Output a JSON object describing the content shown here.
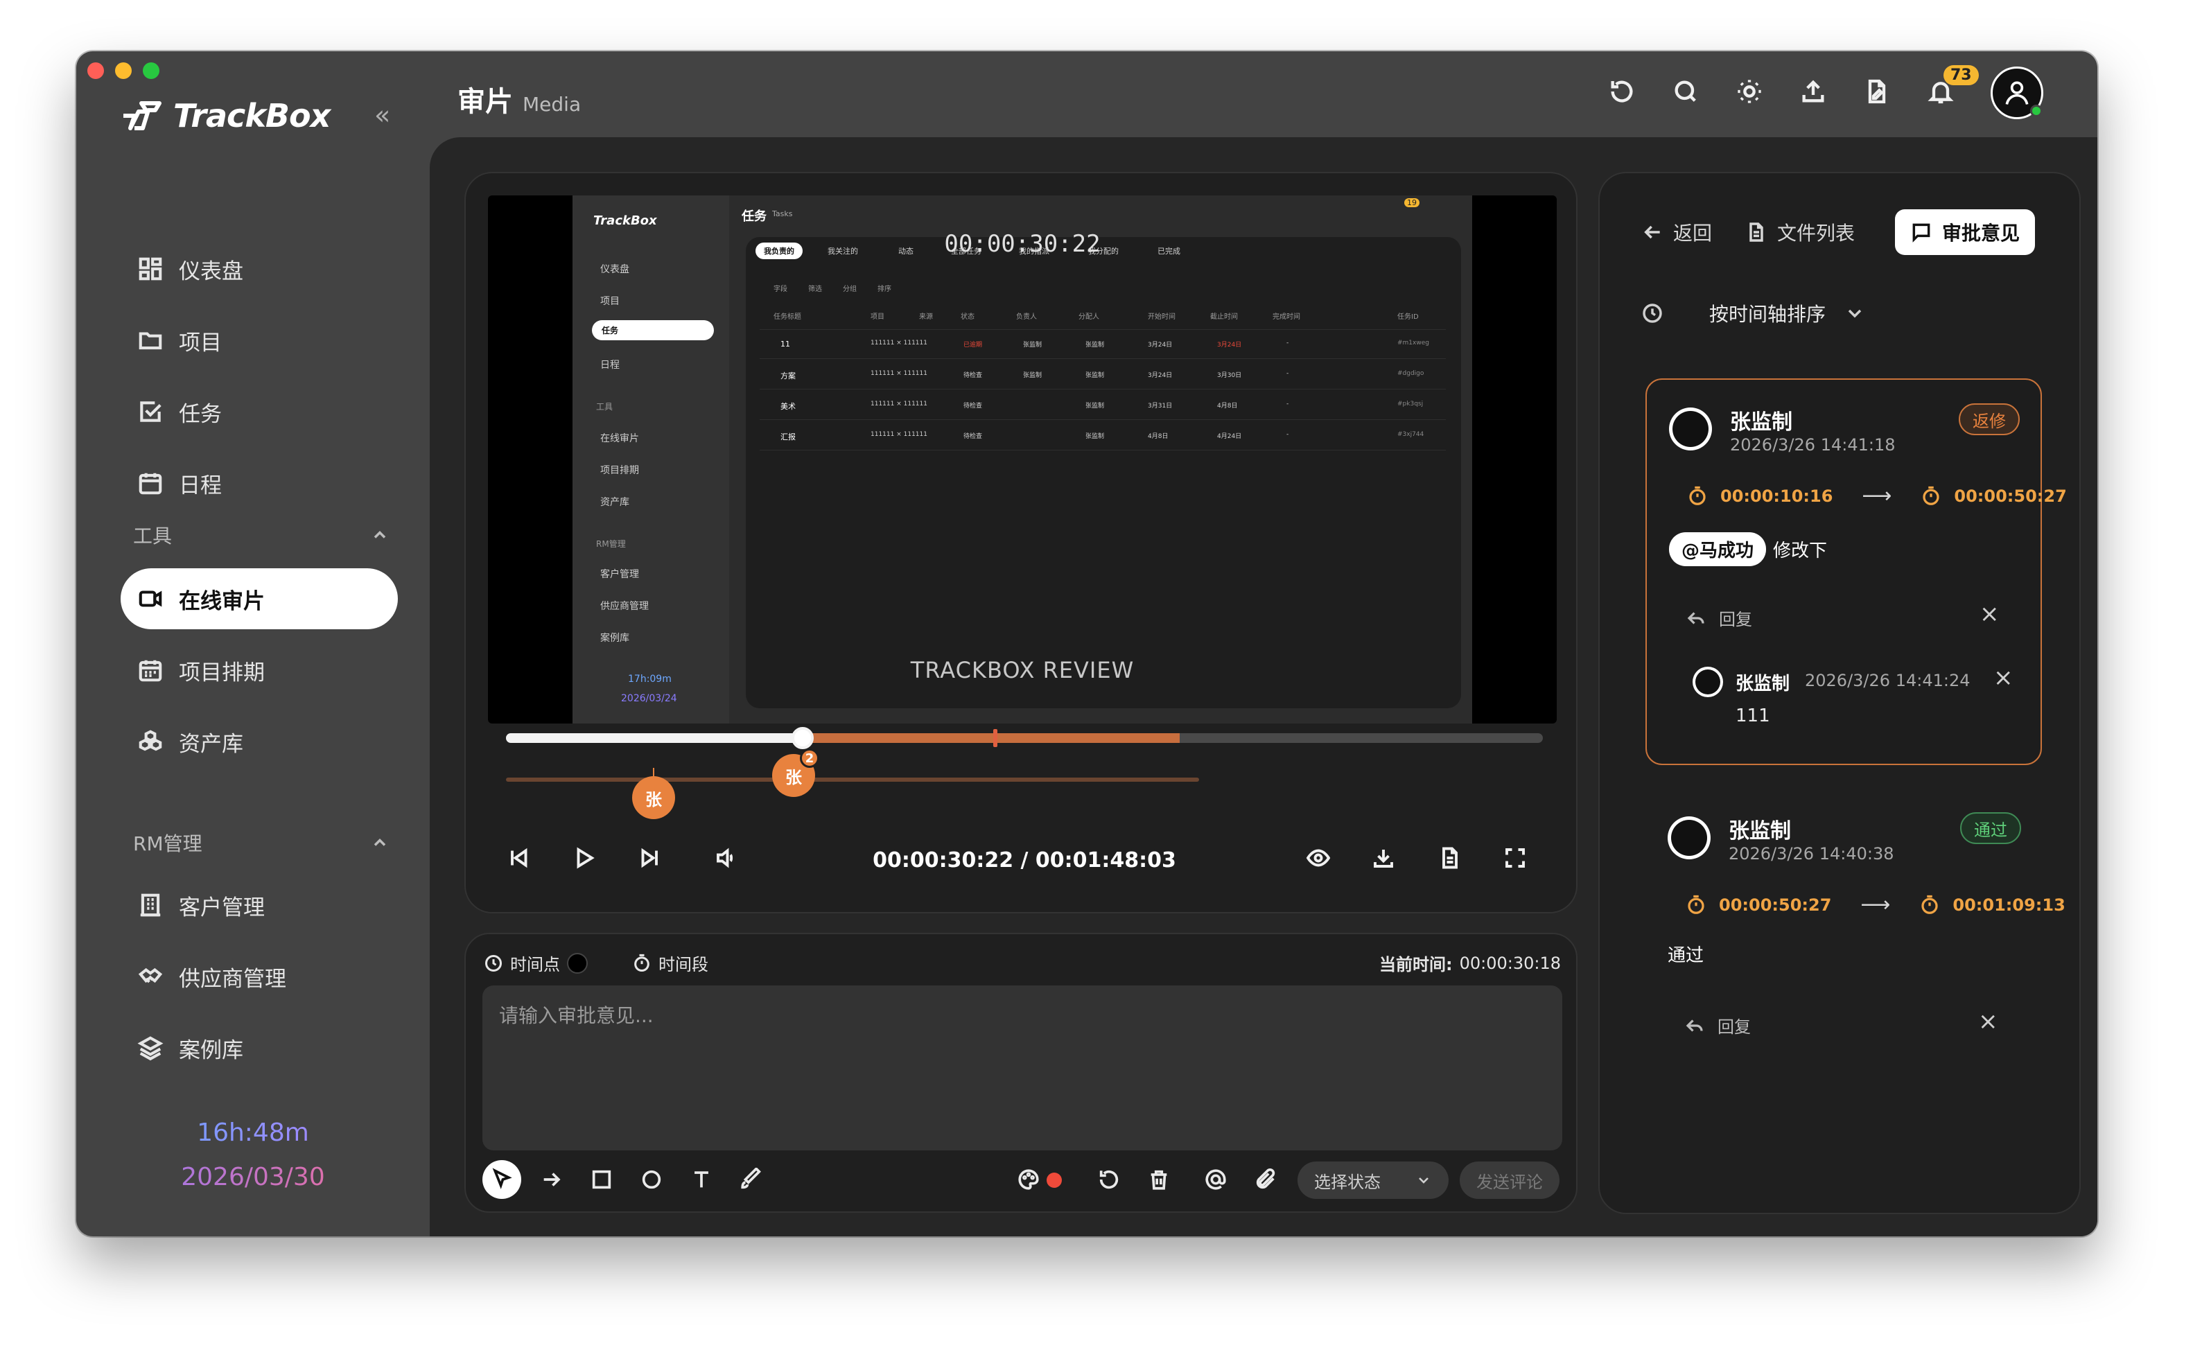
{
  "app": {
    "name": "TrackBox"
  },
  "page": {
    "title": "审片",
    "subtitle": "Media"
  },
  "sidebar": {
    "items": [
      {
        "label": "仪表盘"
      },
      {
        "label": "项目"
      },
      {
        "label": "任务"
      },
      {
        "label": "日程"
      }
    ],
    "section_tools": "工具",
    "tools": [
      {
        "label": "在线审片"
      },
      {
        "label": "项目排期"
      },
      {
        "label": "资产库"
      }
    ],
    "section_rm": "RM管理",
    "rm": [
      {
        "label": "客户管理"
      },
      {
        "label": "供应商管理"
      },
      {
        "label": "案例库"
      }
    ],
    "clock_time": "16h:48m",
    "clock_date": "2026/03/30"
  },
  "topbar": {
    "notification_count": "73"
  },
  "player": {
    "overlay_timecode": "00:00:30:22",
    "watermark": "TRACKBOX REVIEW",
    "played_fraction": 0.286,
    "markers": [
      {
        "label": "张",
        "count": ""
      },
      {
        "label": "张",
        "count": "2"
      }
    ],
    "time_display": "00:00:30:22 / 00:01:48:03"
  },
  "embedded": {
    "logo": "TrackBox",
    "title": "任务",
    "subtitle": "Tasks",
    "badge": "19",
    "tabs": [
      "我负责的",
      "我关注的",
      "动态",
      "全部任务",
      "我的指派",
      "我分配的",
      "已完成"
    ],
    "filters": [
      "字段",
      "筛选",
      "分组",
      "排序"
    ],
    "nav": [
      "仪表盘",
      "项目",
      "任务",
      "日程"
    ],
    "tools_label": "工具",
    "tools": [
      "在线审片",
      "项目排期",
      "资产库"
    ],
    "rm_label": "RM管理",
    "rm": [
      "客户管理",
      "供应商管理",
      "案例库"
    ],
    "clock_time": "17h:09m",
    "clock_date": "2026/03/24",
    "headers": [
      "任务标题",
      "项目",
      "来源",
      "状态",
      "负责人",
      "分配人",
      "开始时间",
      "截止时间",
      "完成时间",
      "任务ID"
    ],
    "rows": [
      {
        "title": "11",
        "project": "111111 × 111111",
        "status": "已逾期",
        "owner": "张监制",
        "assigner": "张监制",
        "start": "3月24日",
        "due": "3月24日",
        "done": "-",
        "id": "#m1xweg"
      },
      {
        "title": "方案",
        "project": "111111 × 111111",
        "status": "待检查",
        "owner": "张监制",
        "assigner": "张监制",
        "start": "3月24日",
        "due": "3月30日",
        "done": "-",
        "id": "#dgdigo"
      },
      {
        "title": "美术",
        "project": "111111 × 111111",
        "status": "待检查",
        "owner": "",
        "assigner": "张监制",
        "start": "3月31日",
        "due": "4月8日",
        "done": "-",
        "id": "#pk3qsj"
      },
      {
        "title": "汇报",
        "project": "111111 × 111111",
        "status": "待检查",
        "owner": "",
        "assigner": "张监制",
        "start": "4月8日",
        "due": "4月24日",
        "done": "-",
        "id": "#3xj744"
      }
    ]
  },
  "composer": {
    "mode_point": "时间点",
    "mode_range": "时间段",
    "current_time_label": "当前时间:",
    "current_time": "00:00:30:18",
    "placeholder": "请输入审批意见...",
    "status_select": "选择状态",
    "send_label": "发送评论"
  },
  "panel": {
    "tab_back": "返回",
    "tab_files": "文件列表",
    "tab_review": "审批意见",
    "sort_label": "按时间轴排序",
    "comments": [
      {
        "name": "张监制",
        "date": "2026/3/26 14:41:18",
        "status": "返修",
        "start": "00:00:10:16",
        "end": "00:00:50:27",
        "mention": "@马成功",
        "text": "修改下",
        "reply_label": "回复",
        "reply": {
          "name": "张监制",
          "date": "2026/3/26 14:41:24",
          "text": "111"
        }
      },
      {
        "name": "张监制",
        "date": "2026/3/26 14:40:38",
        "status": "通过",
        "start": "00:00:50:27",
        "end": "00:01:09:13",
        "text": "通过",
        "reply_label": "回复"
      }
    ]
  },
  "colors": {
    "accent_orange": "#e8823e",
    "status_fix": "#e8823e",
    "status_pass": "#5fd07a",
    "timeline_range": "#c76e3e"
  }
}
